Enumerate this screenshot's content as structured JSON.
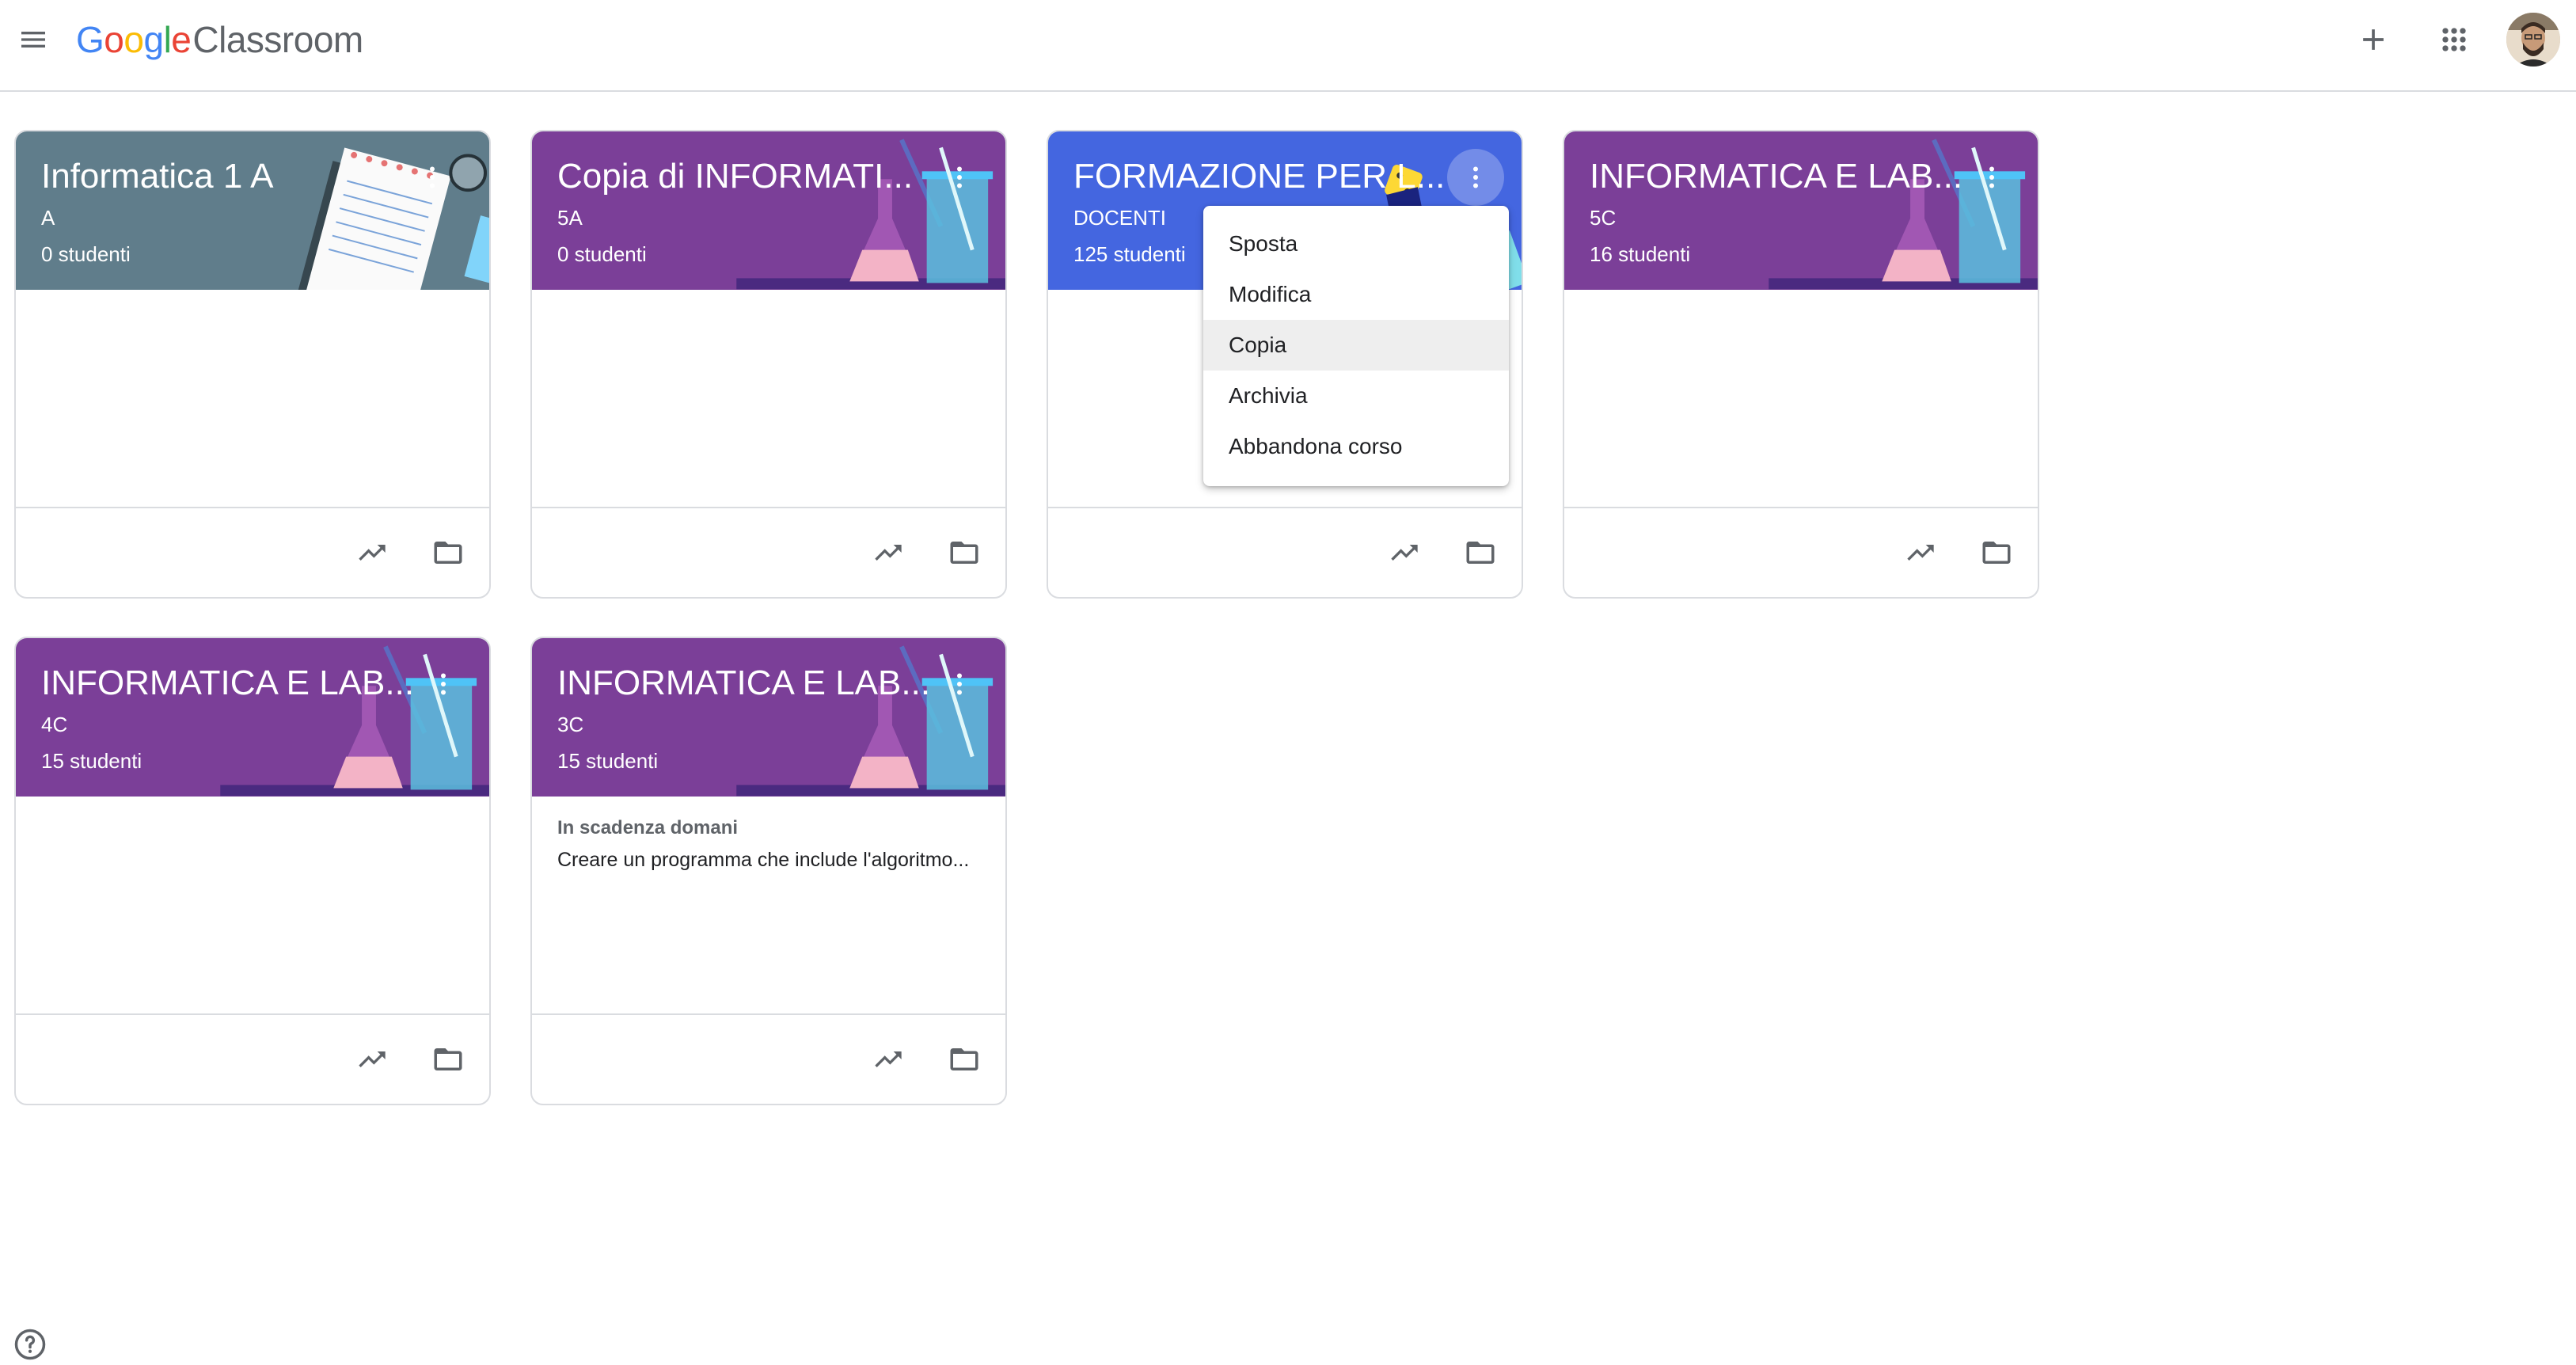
{
  "app": {
    "logo_google": [
      "G",
      "o",
      "o",
      "g",
      "l",
      "e"
    ],
    "logo_product": "Classroom",
    "logo_colors": [
      "#4285F4",
      "#EA4335",
      "#FBBC05",
      "#4285F4",
      "#34A853",
      "#EA4335"
    ]
  },
  "topbar": {
    "menu_icon": "hamburger-menu-icon",
    "add_icon": "plus-icon",
    "apps_icon": "apps-grid-icon",
    "avatar_icon": "user-avatar"
  },
  "theme": {
    "gray_header": "#607d8b",
    "purple_header": "#7b3f98",
    "blue_header": "#4466e0"
  },
  "courses": [
    {
      "title": "Informatica 1 A",
      "section": "A",
      "students": "0 studenti",
      "theme": "gray"
    },
    {
      "title": "Copia di INFORMATI...",
      "section": "5A",
      "students": "0 studenti",
      "theme": "purple"
    },
    {
      "title": "FORMAZIONE PER L...",
      "section": "DOCENTI",
      "students": "125 studenti",
      "theme": "blue"
    },
    {
      "title": "INFORMATICA E LAB...",
      "section": "5C",
      "students": "16 studenti",
      "theme": "purple"
    },
    {
      "title": "INFORMATICA E LAB...",
      "section": "4C",
      "students": "15 studenti",
      "theme": "purple"
    },
    {
      "title": "INFORMATICA E LAB...",
      "section": "3C",
      "students": "15 studenti",
      "theme": "purple",
      "due_label": "In scadenza domani",
      "due_text": "Creare un programma che include l'algoritmo..."
    }
  ],
  "card_actions": {
    "trend_icon": "trending-up-icon",
    "folder_icon": "folder-icon"
  },
  "menu": {
    "items": [
      "Sposta",
      "Modifica",
      "Copia",
      "Archivia",
      "Abbandona corso"
    ],
    "highlighted": "Copia"
  },
  "help_icon": "help-circle-icon"
}
